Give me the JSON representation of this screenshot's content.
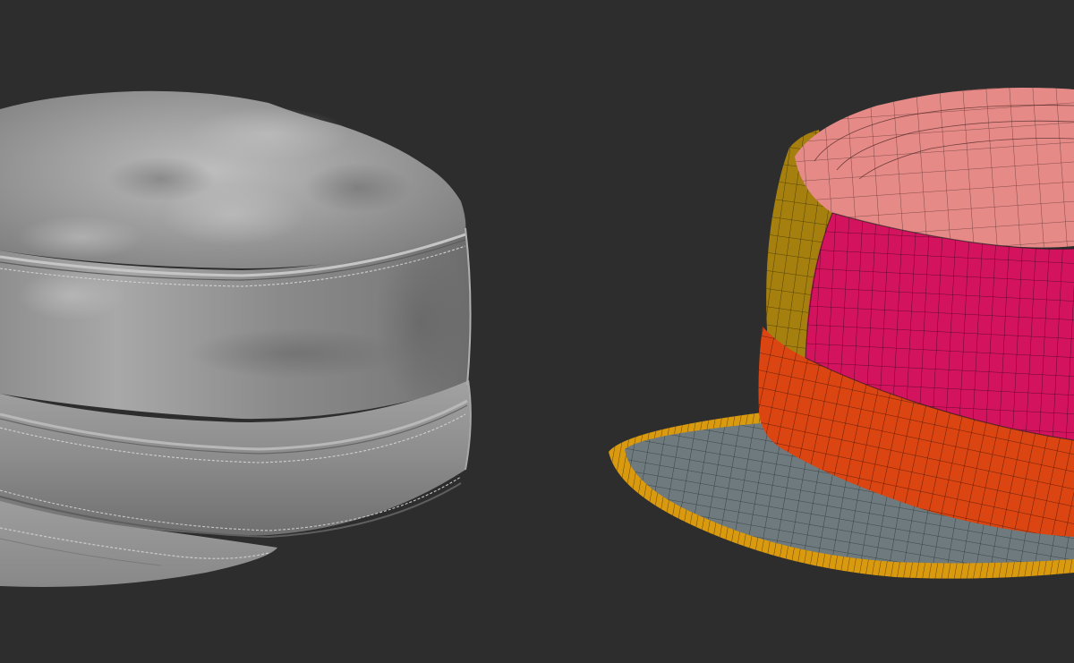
{
  "scene": {
    "background": "#2d2d2d",
    "models": [
      {
        "name": "sculpted-cap",
        "material": "grey-clay",
        "base_color": "#9a9a9a"
      },
      {
        "name": "polygroup-cap",
        "material": "wireframe-polygroups",
        "polygroup_colors": {
          "crown": "#e58a86",
          "side-front": "#d4135e",
          "side-back": "#a6800e",
          "band": "#db4512",
          "visor-top": "#6e7a7d",
          "visor-edge": "#d99a10"
        }
      }
    ]
  }
}
